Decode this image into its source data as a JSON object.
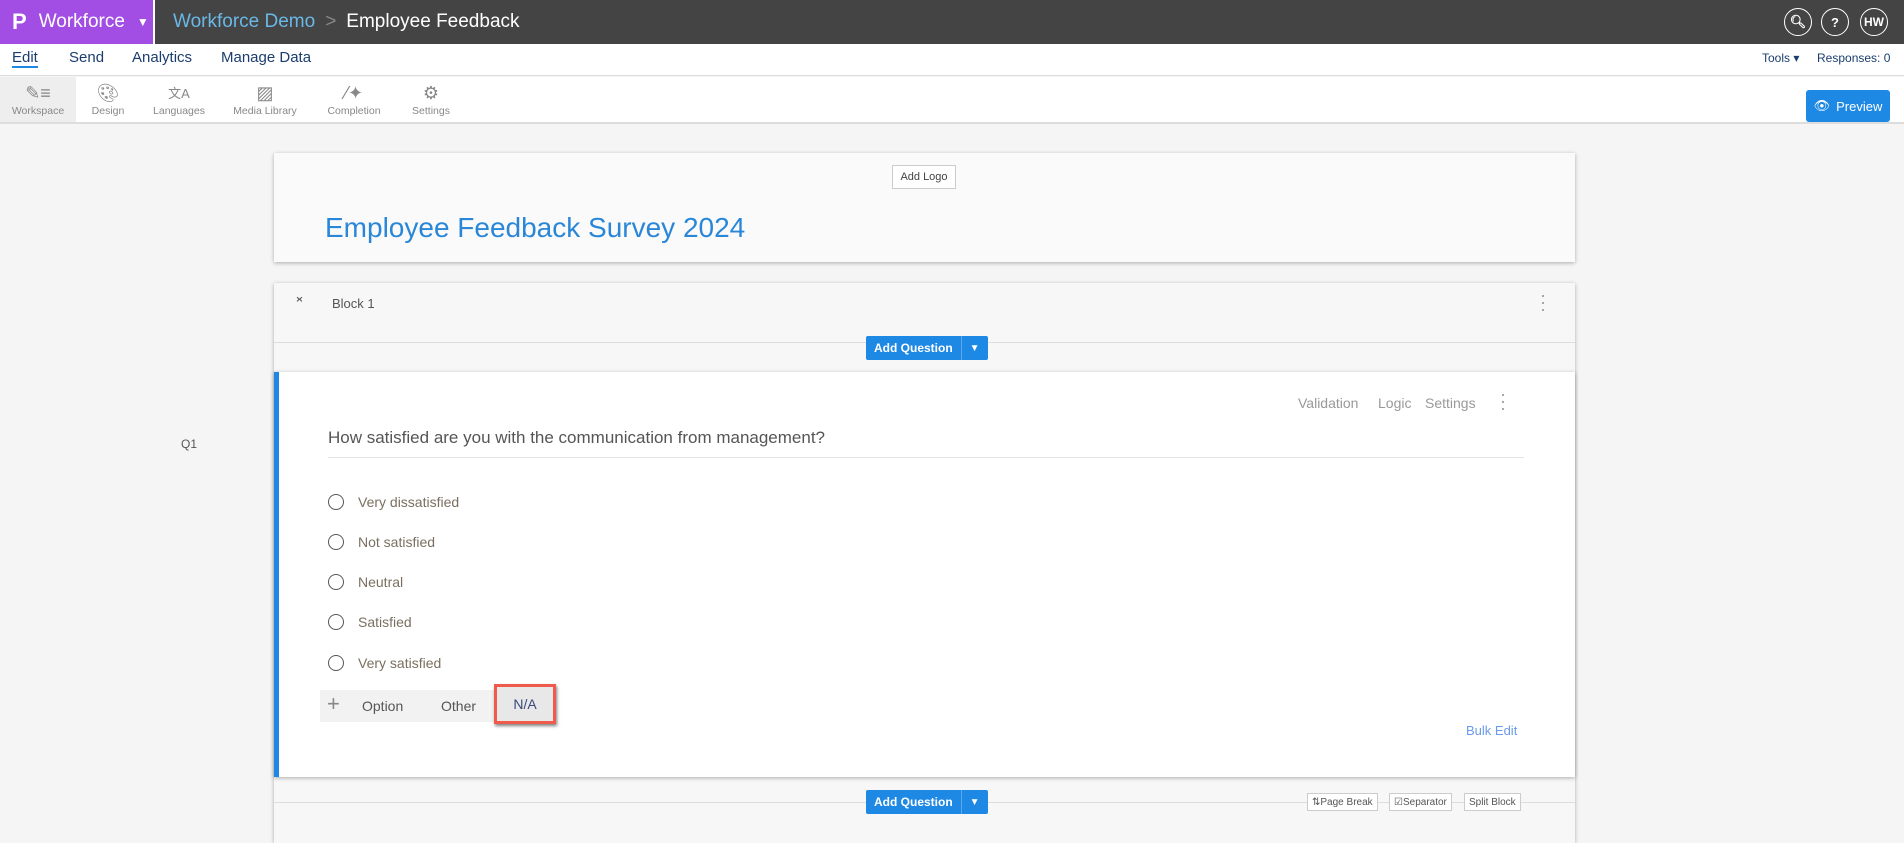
{
  "topbar": {
    "brand": "Workforce",
    "crumb_parent": "Workforce Demo",
    "crumb_separator": ">",
    "crumb_current": "Employee Feedback",
    "user_initials": "HW"
  },
  "nav": {
    "items": [
      "Edit",
      "Send",
      "Analytics",
      "Manage Data"
    ],
    "active": "Edit",
    "tools": "Tools ▾",
    "responses": "Responses: 0"
  },
  "toolbar": {
    "items": [
      "Workspace",
      "Design",
      "Languages",
      "Media Library",
      "Completion",
      "Settings"
    ],
    "preview": "Preview"
  },
  "survey": {
    "add_logo": "Add Logo",
    "title": "Employee Feedback Survey 2024"
  },
  "block": {
    "name": "Block 1",
    "add_question": "Add Question",
    "page_break": "Page Break",
    "separator": "Separator",
    "split_block": "Split Block"
  },
  "question": {
    "number": "Q1",
    "text": "How satisfied are you with the communication from management?",
    "actions": [
      "Validation",
      "Logic",
      "Settings"
    ],
    "options": [
      "Very dissatisfied",
      "Not satisfied",
      "Neutral",
      "Satisfied",
      "Very satisfied"
    ],
    "add_option": "Option",
    "add_other": "Other",
    "add_na": "N/A",
    "bulk_edit": "Bulk Edit"
  },
  "colors": {
    "brand": "#a24de3",
    "accent": "#1e88e5",
    "highlight": "#f05a4a"
  }
}
